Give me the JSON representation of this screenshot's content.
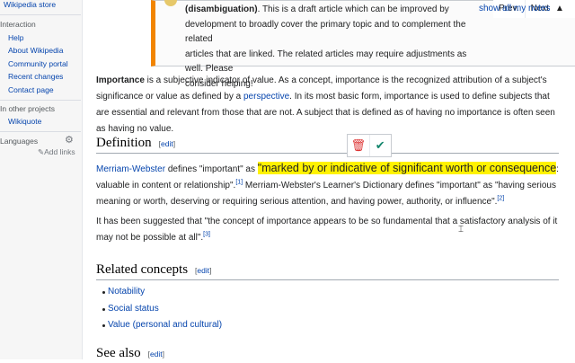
{
  "sidebar": {
    "top_link": "Wikipedia store",
    "interaction_heading": "Interaction",
    "interaction_links": [
      "Help",
      "About Wikipedia",
      "Community portal",
      "Recent changes",
      "Contact page"
    ],
    "other_projects_heading": "In other projects",
    "other_projects_links": [
      "Wikiquote"
    ],
    "languages_heading": "Languages",
    "add_links": "Add links"
  },
  "notice": {
    "bold_part": "(disambiguation)",
    "text_rest": ". This is a draft article which can be improved by",
    "line2": "development to broadly cover the primary topic and to complement the related",
    "line3": "articles that are linked. The related articles may require adjustments as well. Please",
    "line4": "consider helping!",
    "nav_prev": "Prev.",
    "nav_next": "Next",
    "nav_show_all": "show all my notes",
    "nav_up": "▲"
  },
  "intro": {
    "term": "Importance",
    "text_a": " is a subjective indicator of value. As a concept, importance is the recognized attribution of a subject's significance or value as defined by a ",
    "link_perspective": "perspective",
    "text_b": ". In its most basic form, importance is used to define subjects that are essential and relevant from those that are not. A subject that is defined as of having no importance is often seen as having no value."
  },
  "definition": {
    "heading": "Definition",
    "edit_open": "[",
    "edit_label": "edit",
    "edit_close": "]",
    "source_link": "Merriam-Webster",
    "text_a": " defines \"important\" as ",
    "highlighted": "\"marked by or indicative of significant worth or consequence",
    "text_b": ": valuable in content or relationship\".",
    "ref1": "[1]",
    "text_c": " Merriam-Webster's Learner's Dictionary defines \"important\" as \"having serious meaning or worth, deserving or requiring serious attention, and having power, authority, or influence\".",
    "ref2": "[2]",
    "para2": "It has been suggested that \"the concept of importance appears to be so fundamental that a satisfactory analysis of it may not be possible at all\".",
    "ref3": "[3]"
  },
  "related": {
    "heading": "Related concepts",
    "edit_open": "[",
    "edit_label": "edit",
    "edit_close": "]",
    "items": [
      "Notability",
      "Social status",
      "Value (personal and cultural)"
    ]
  },
  "see_also": {
    "heading": "See also",
    "edit_open": "[",
    "edit_label": "edit",
    "edit_close": "]"
  },
  "toolbar": {
    "delete_glyph": "🗑",
    "confirm_glyph": "✔"
  },
  "colors": {
    "link": "#0645ad",
    "highlight": "#fff200",
    "notice_border": "#f28500"
  }
}
